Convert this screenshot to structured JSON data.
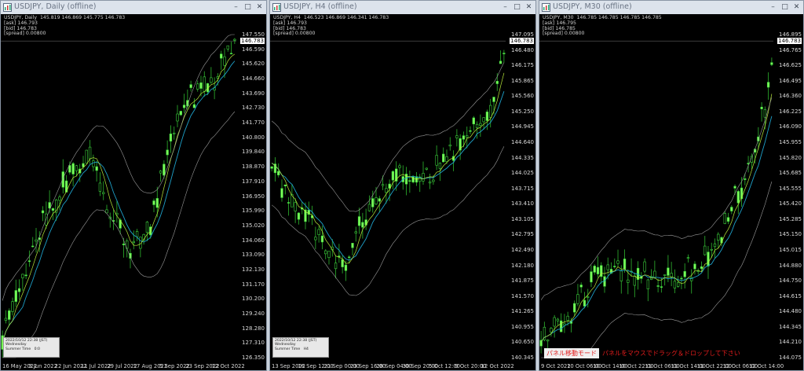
{
  "windows": [
    {
      "title": "USDJPY, Daily (offline)",
      "info": [
        "USDJPY, Daily  145.819 146.869 145.775 146.783",
        "[ask] 146.793",
        "[bid] 146.783",
        "[spread] 0.00800"
      ],
      "current_price": "146.783",
      "price_labels": [
        "147.550",
        "146.590",
        "145.620",
        "144.660",
        "143.690",
        "142.730",
        "141.770",
        "140.800",
        "139.840",
        "138.870",
        "137.910",
        "136.950",
        "135.990",
        "135.020",
        "134.060",
        "133.090",
        "132.130",
        "131.170",
        "130.200",
        "129.240",
        "128.280",
        "127.310",
        "126.350"
      ],
      "time_labels": [
        "16 May 2022",
        "3 Jun 2022",
        "22 Jun 2022",
        "11 Jul 2022",
        "29 Jul 2022",
        "17 Aug 2022",
        "5 Sep 2022",
        "23 Sep 2022",
        "12 Oct 2022"
      ],
      "mini_panel": [
        "2022/10/12 22:38 (JST)",
        "Wednesday",
        "Summer Time   0:0"
      ]
    },
    {
      "title": "USDJPY, H4 (offline)",
      "info": [
        "USDJPY, H4  146.523 146.869 146.341 146.783",
        "[ask] 146.793",
        "[bid] 146.783",
        "[spread] 0.00800"
      ],
      "current_price": "146.783",
      "price_labels": [
        "147.095",
        "146.480",
        "146.175",
        "145.865",
        "145.560",
        "145.250",
        "144.945",
        "144.640",
        "144.335",
        "144.025",
        "143.715",
        "143.410",
        "143.105",
        "142.795",
        "142.490",
        "142.180",
        "141.875",
        "141.570",
        "141.265",
        "140.955",
        "140.650",
        "140.345"
      ],
      "time_labels": [
        "13 Sep 2022",
        "16 Sep 12:00",
        "21 Sep 00:00",
        "23 Sep 16:00",
        "28 Sep 04:00",
        "30 Sep 20:00",
        "5 Oct 12:00",
        "9 Oct 20:00",
        "12 Oct 2022"
      ],
      "mini_panel": [
        "2022/10/12 22:38 (JST)",
        "Wednesday",
        "Summer Time   H4"
      ]
    },
    {
      "title": "USDJPY, M30 (offline)",
      "info": [
        "USDJPY, M30  146.785 146.785 146.785 146.785",
        "[ask] 146.795",
        "[bid] 146.785",
        "[spread] 0.00800"
      ],
      "current_price": "146.783",
      "price_labels": [
        "146.895",
        "146.765",
        "146.625",
        "146.495",
        "146.360",
        "146.225",
        "146.090",
        "145.955",
        "145.820",
        "145.685",
        "145.555",
        "145.420",
        "145.285",
        "145.150",
        "145.015",
        "144.880",
        "144.750",
        "144.615",
        "144.480",
        "144.345",
        "144.210",
        "144.075"
      ],
      "time_labels": [
        "9 Oct 2022",
        "10 Oct 06:00",
        "10 Oct 14:00",
        "10 Oct 22:00",
        "11 Oct 06:00",
        "11 Oct 14:00",
        "11 Oct 22:00",
        "12 Oct 06:00",
        "12 Oct 14:00"
      ],
      "notice": "パネル移動モード",
      "notice2": "パネルをマウスでドラッグ＆ドロップして下さい"
    }
  ]
}
